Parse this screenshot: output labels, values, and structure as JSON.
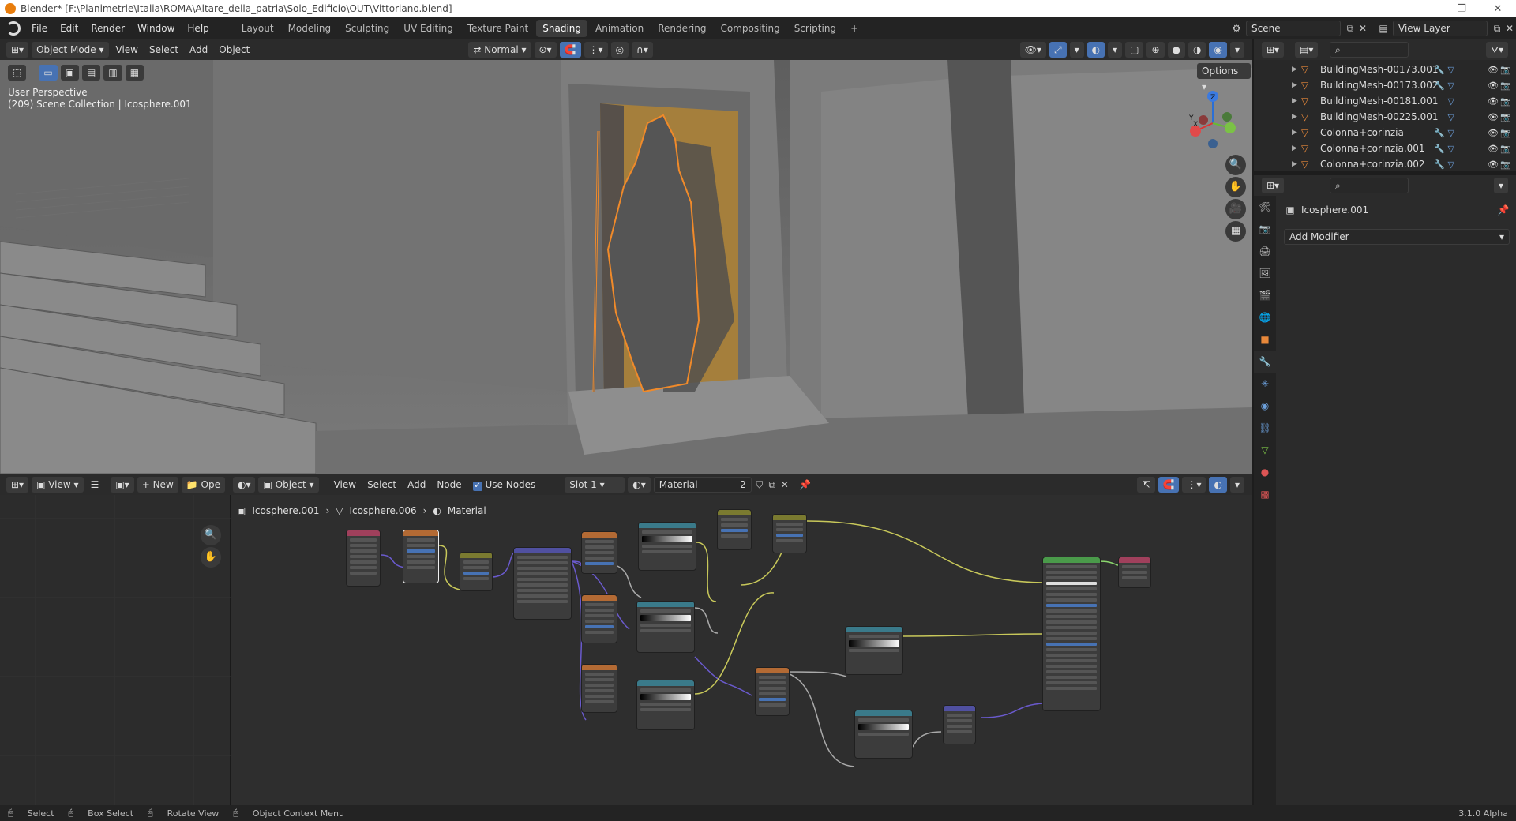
{
  "window": {
    "title": "Blender* [F:\\Planimetrie\\Italia\\ROMA\\Altare_della_patria\\Solo_Edificio\\OUT\\Vittoriano.blend]"
  },
  "menu": [
    "File",
    "Edit",
    "Render",
    "Window",
    "Help"
  ],
  "workspaces": [
    "Layout",
    "Modeling",
    "Sculpting",
    "UV Editing",
    "Texture Paint",
    "Shading",
    "Animation",
    "Rendering",
    "Compositing",
    "Scripting"
  ],
  "active_workspace": "Shading",
  "scene": {
    "name": "Scene",
    "view_layer": "View Layer"
  },
  "viewport": {
    "mode": "Object Mode",
    "menus": [
      "View",
      "Select",
      "Add",
      "Object"
    ],
    "orientation": "Normal",
    "options_label": "Options",
    "perspective": "User Perspective",
    "collection_info": "(209) Scene Collection | Icosphere.001",
    "gizmo": {
      "x": "X",
      "y": "Y",
      "z": "Z"
    }
  },
  "node_editor": {
    "view_label": "View",
    "new_label": "New",
    "open_label": "Ope",
    "object_label": "Object",
    "menus": [
      "View",
      "Select",
      "Add",
      "Node"
    ],
    "use_nodes_label": "Use Nodes",
    "use_nodes": true,
    "slot": "Slot 1",
    "material": "Material",
    "users": "2",
    "breadcrumb": [
      "Icosphere.001",
      "Icosphere.006",
      "Material"
    ]
  },
  "outliner": {
    "items": [
      {
        "label": "BuildingMesh-00173.001"
      },
      {
        "label": "BuildingMesh-00173.002"
      },
      {
        "label": "BuildingMesh-00181.001"
      },
      {
        "label": "BuildingMesh-00225.001"
      },
      {
        "label": "Colonna+corinzia"
      },
      {
        "label": "Colonna+corinzia.001"
      },
      {
        "label": "Colonna+corinzia.002"
      }
    ]
  },
  "properties": {
    "object_name": "Icosphere.001",
    "add_modifier": "Add Modifier"
  },
  "statusbar": {
    "select": "Select",
    "box_select": "Box Select",
    "rotate_view": "Rotate View",
    "context_menu": "Object Context Menu",
    "version": "3.1.0 Alpha"
  },
  "colors": {
    "accent": "#4772b3",
    "orange": "#e8883a",
    "header": "#2b2b2b"
  }
}
